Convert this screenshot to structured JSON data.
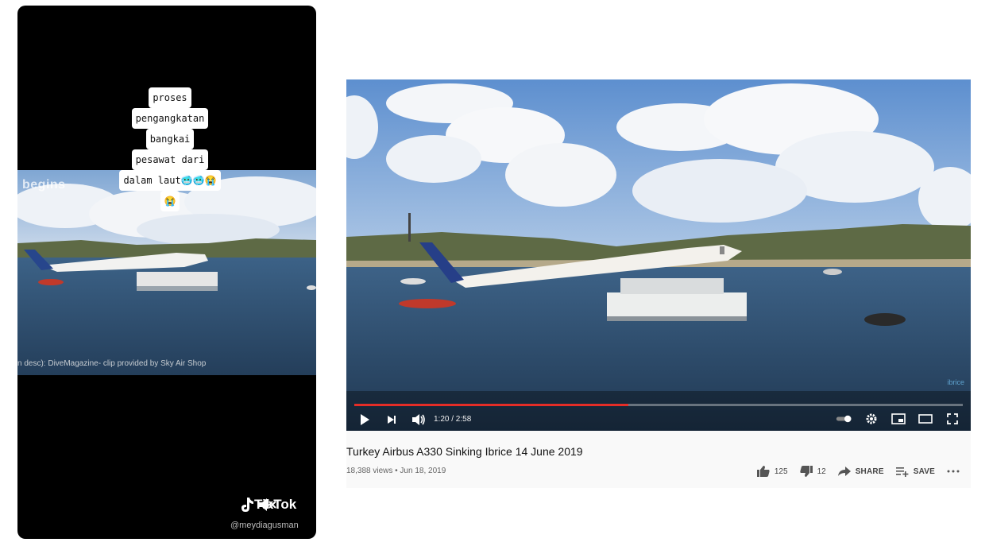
{
  "tiktok": {
    "caption_lines": [
      "proses",
      "pengangkatan",
      "bangkai",
      "pesawat dari",
      "dalam laut🥶🥶😭",
      "😭"
    ],
    "overlay_begins": "begins",
    "credit": "n desc): DiveMagazine- clip provided by Sky Air Shop",
    "brand": "TikTok",
    "username": "@meydiagusman"
  },
  "youtube": {
    "time": "1:20 / 2:58",
    "progress": 0.45,
    "title": "Turkey Airbus A330 Sinking Ibrice 14 June 2019",
    "meta": "18,388 views • Jun 18, 2019",
    "like_count": "125",
    "dislike_count": "12",
    "share_label": "SHARE",
    "save_label": "SAVE"
  },
  "colors": {
    "progress_red": "#e52d27",
    "sky": "#6f9fd6",
    "sea": "#2b4d6e"
  }
}
